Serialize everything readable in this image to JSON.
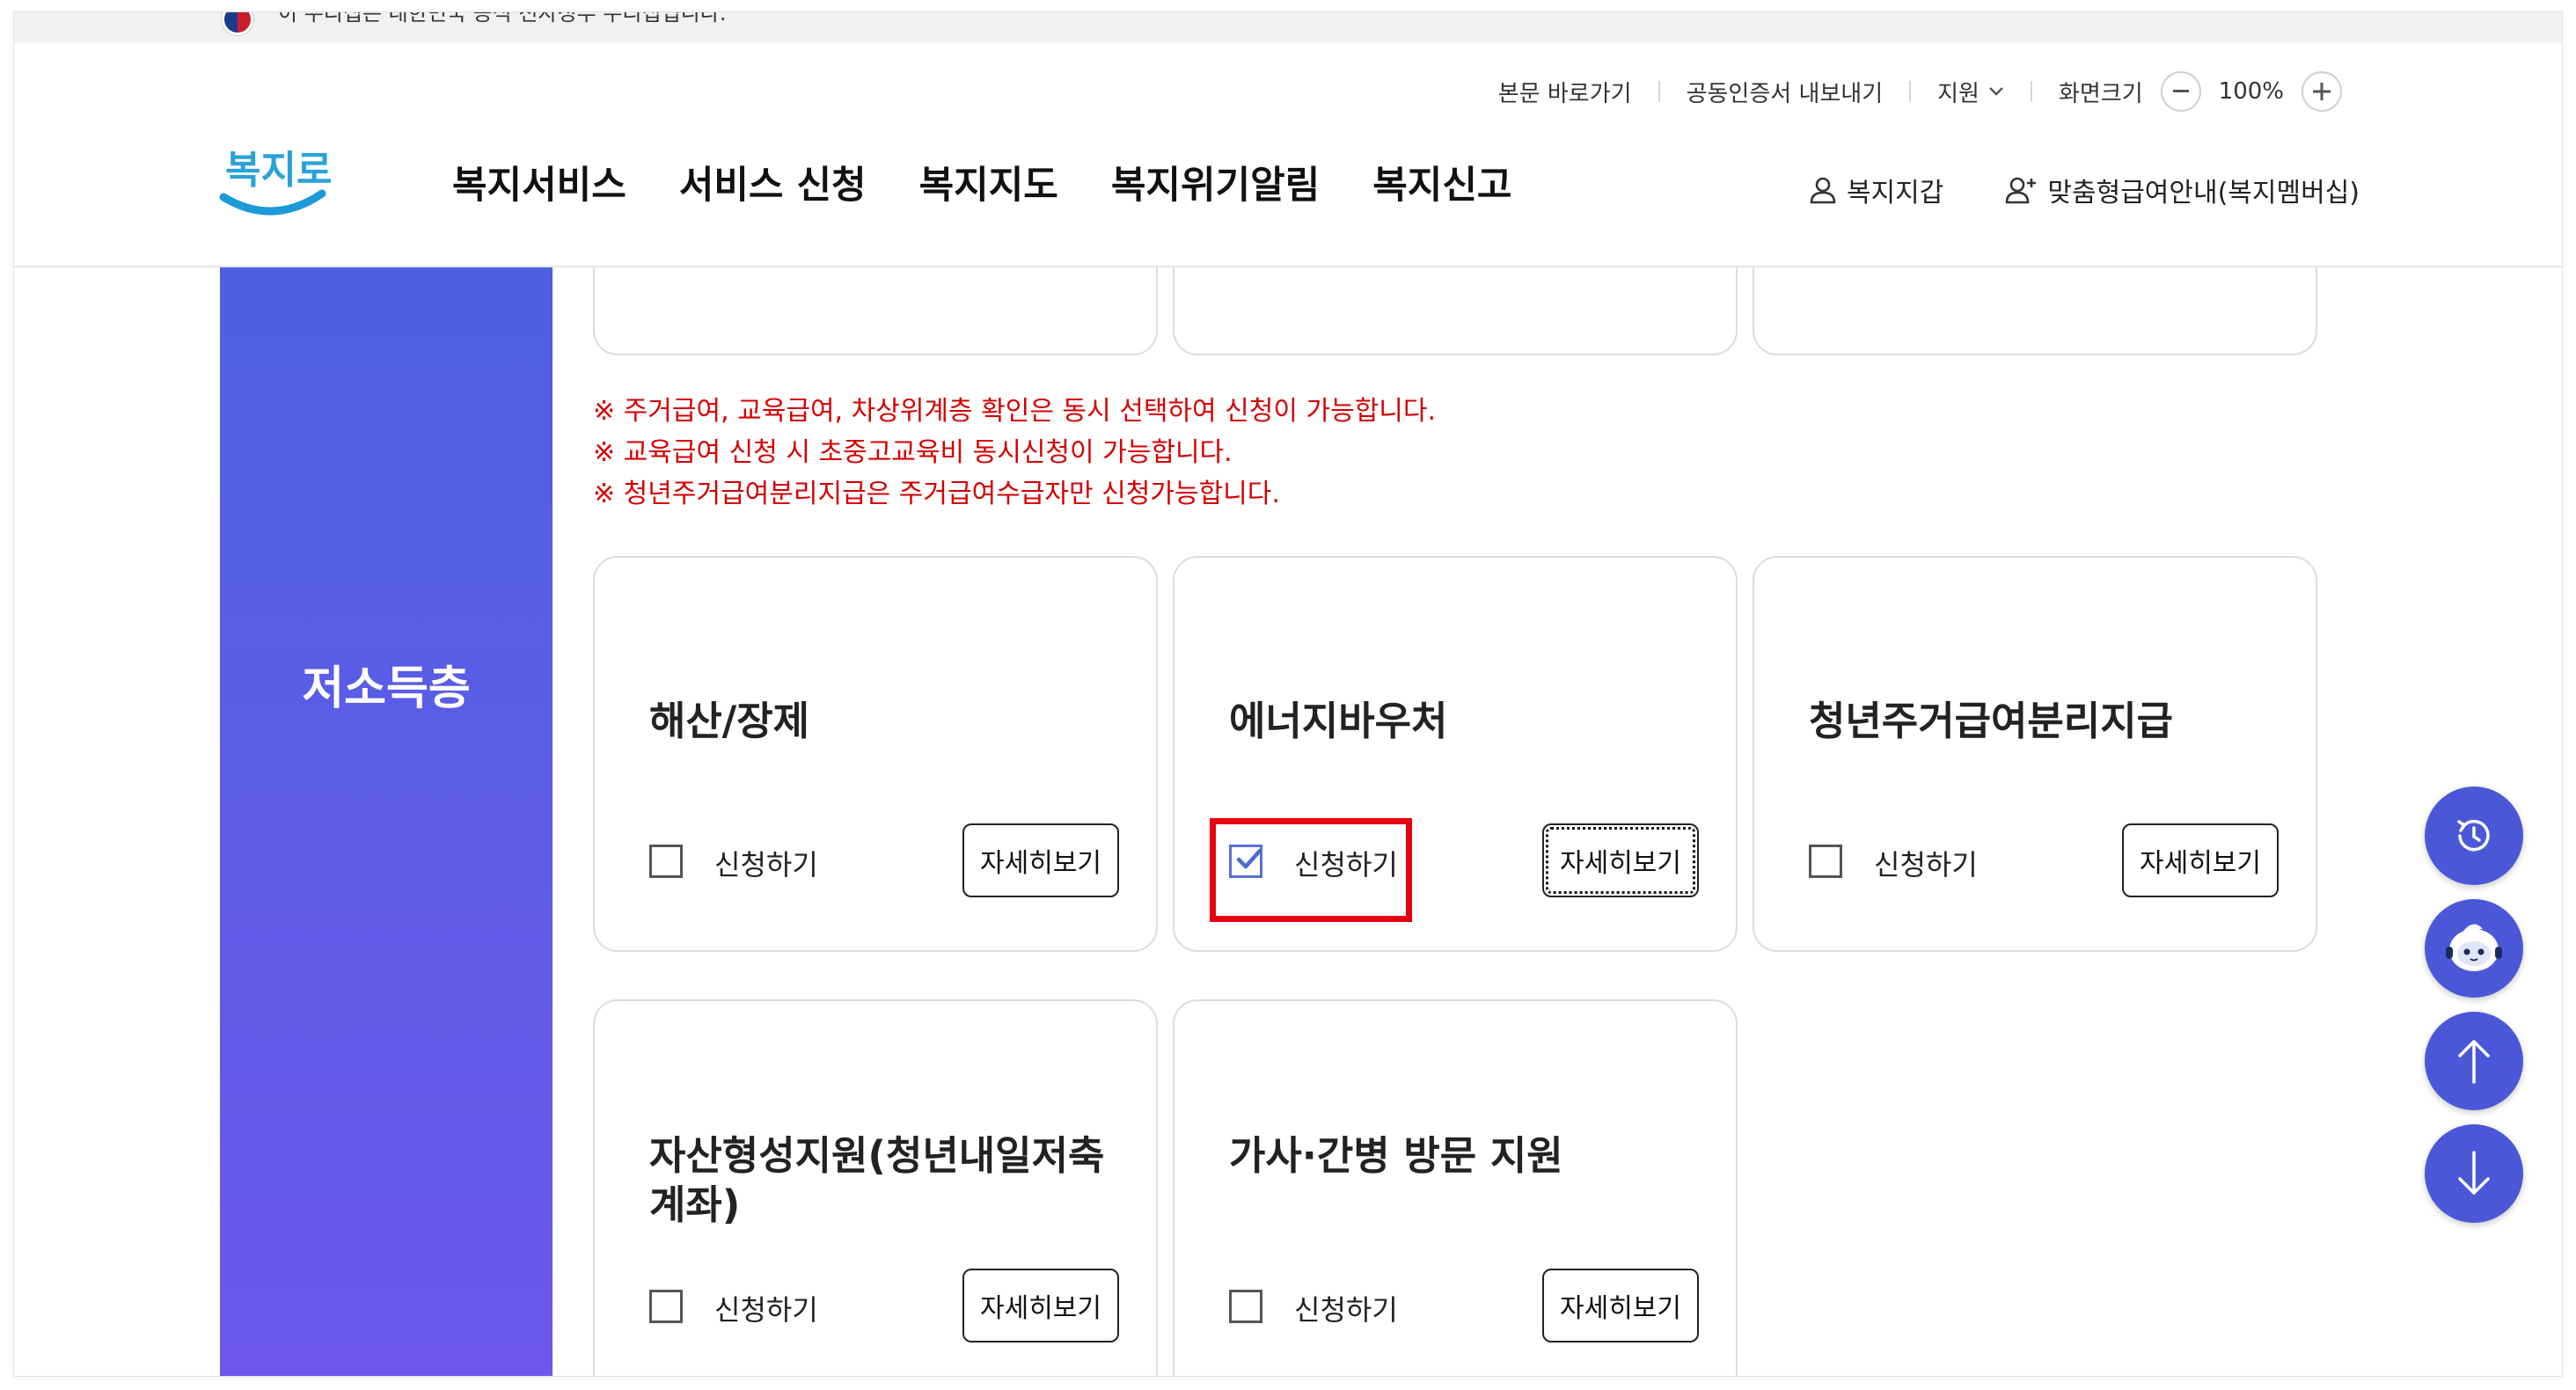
{
  "gov_banner": {
    "text": "이 누리집은 대한민국 공식 전자정부 누리집입니다."
  },
  "utility": {
    "skip": "본문 바로가기",
    "cert": "공동인증서 내보내기",
    "support": "지원",
    "screen_size": "화면크기",
    "zoom": "100%"
  },
  "logo": {
    "text": "복지로"
  },
  "gnb": [
    "복지서비스",
    "서비스 신청",
    "복지지도",
    "복지위기알림",
    "복지신고"
  ],
  "member": {
    "wallet": "복지지갑",
    "custom": "맞춤형급여안내(복지멤버십)"
  },
  "category": {
    "title": "저소득층"
  },
  "notices": [
    "※ 주거급여, 교육급여, 차상위계층 확인은 동시 선택하여 신청이 가능합니다.",
    "※ 교육급여 신청 시 초중고교육비 동시신청이 가능합니다.",
    "※ 청년주거급여분리지급은 주거급여수급자만 신청가능합니다."
  ],
  "cards": [
    {
      "title": "해산/장제",
      "apply": "신청하기",
      "detail": "자세히보기",
      "checked": false
    },
    {
      "title": "에너지바우처",
      "apply": "신청하기",
      "detail": "자세히보기",
      "checked": true
    },
    {
      "title": "청년주거급여분리지급",
      "apply": "신청하기",
      "detail": "자세히보기",
      "checked": false
    },
    {
      "title": "자산형성지원(청년내일저축계좌)",
      "apply": "신청하기",
      "detail": "자세히보기",
      "checked": false
    },
    {
      "title": "가사·간병 방문 지원",
      "apply": "신청하기",
      "detail": "자세히보기",
      "checked": false
    }
  ],
  "colors": {
    "accent": "#4a58d8",
    "category_top": "#4f5fe2",
    "category_bottom": "#6e57ec",
    "notice": "#d40000",
    "highlight": "#e60012"
  },
  "fab_icons": [
    "history-icon",
    "chatbot-icon",
    "arrow-up-icon",
    "arrow-down-icon"
  ]
}
